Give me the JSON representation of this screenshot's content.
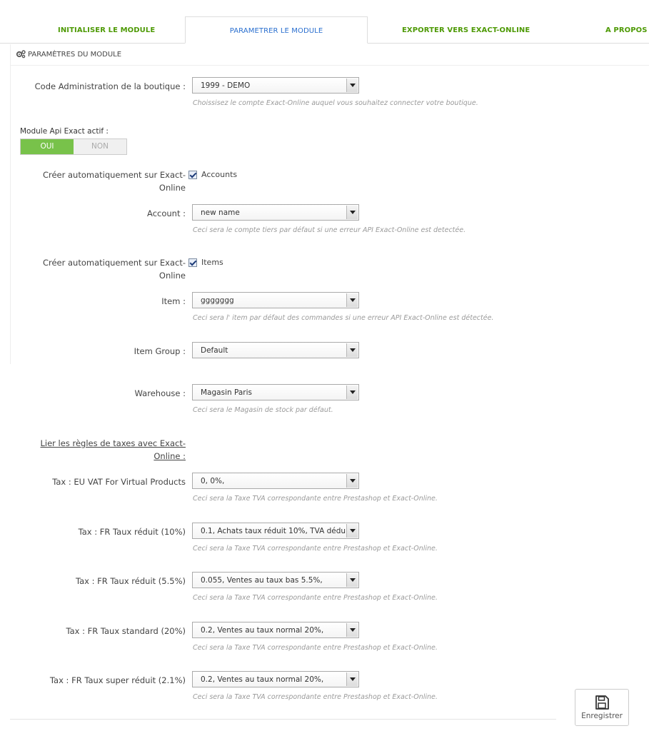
{
  "tabs": [
    {
      "label": "INITIALISER LE MODULE"
    },
    {
      "label": "PARAMETRER LE MODULE"
    },
    {
      "label": "EXPORTER VERS EXACT-ONLINE"
    },
    {
      "label": "A PROPOS"
    }
  ],
  "panel": {
    "title": "PARAMÈTRES DU MODULE"
  },
  "shop_code": {
    "label": "Code Administration de la boutique :",
    "value": "1999 - DEMO",
    "help": "Choissisez le compte Exact-Online auquel vous souhaitez connecter votre boutique."
  },
  "api_toggle": {
    "label": "Module Api Exact actif :",
    "on": "OUI",
    "off": "NON"
  },
  "auto_accounts": {
    "label": "Créer automatiquement sur Exact-Online",
    "option": "Accounts"
  },
  "account": {
    "label": "Account :",
    "value": "new name",
    "help": "Ceci sera le compte tiers par défaut si une erreur API Exact-Online est detectée."
  },
  "auto_items": {
    "label": "Créer automatiquement sur Exact-Online",
    "option": "Items"
  },
  "item": {
    "label": "Item :",
    "value": "ggggggg",
    "help": "Ceci sera l' item par défaut des commandes si une erreur API Exact-Online est détectée."
  },
  "item_group": {
    "label": "Item Group :",
    "value": "Default"
  },
  "warehouse": {
    "label": "Warehouse :",
    "value": "Magasin Paris",
    "help": "Ceci sera le Magasin de stock par défaut."
  },
  "tax_section": {
    "label": "Lier les règles de taxes avec Exact-Online :"
  },
  "taxes": [
    {
      "label": "Tax : EU VAT For Virtual Products",
      "value": "0, 0%,",
      "help": "Ceci sera la Taxe TVA correspondante entre Prestashop et Exact-Online."
    },
    {
      "label": "Tax : FR Taux réduit (10%)",
      "value": "0.1, Achats taux réduit 10%, TVA dédu",
      "help": "Ceci sera la Taxe TVA correspondante entre Prestashop et Exact-Online."
    },
    {
      "label": "Tax : FR Taux réduit (5.5%)",
      "value": "0.055, Ventes au taux bas 5.5%,",
      "help": "Ceci sera la Taxe TVA correspondante entre Prestashop et Exact-Online."
    },
    {
      "label": "Tax : FR Taux standard (20%)",
      "value": "0.2, Ventes au taux normal 20%,",
      "help": "Ceci sera la Taxe TVA correspondante entre Prestashop et Exact-Online."
    },
    {
      "label": "Tax : FR Taux super réduit (2.1%)",
      "value": "0.2, Ventes au taux normal 20%,",
      "help": "Ceci sera la Taxe TVA correspondante entre Prestashop et Exact-Online."
    }
  ],
  "save_button": {
    "label": "Enregistrer"
  },
  "colors": {
    "tab_text": "#4e9a06",
    "tab_active": "#2a6fcf",
    "toggle_on": "#78c24a"
  }
}
